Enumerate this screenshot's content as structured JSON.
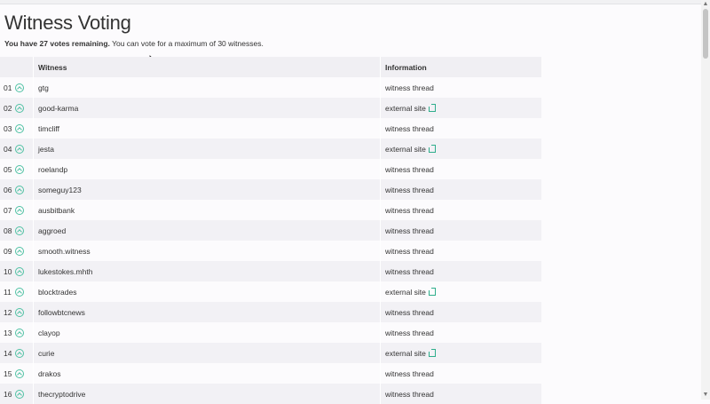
{
  "page": {
    "title": "Witness Voting",
    "votes_bold": "You have 27 votes remaining.",
    "votes_rest": " You can vote for a maximum of 30 witnesses."
  },
  "table": {
    "headers": {
      "rank": "",
      "witness": "Witness",
      "information": "Information"
    },
    "rows": [
      {
        "rank": "01",
        "name": "gtg",
        "info": "witness thread",
        "external": false
      },
      {
        "rank": "02",
        "name": "good-karma",
        "info": "external site",
        "external": true
      },
      {
        "rank": "03",
        "name": "timcliff",
        "info": "witness thread",
        "external": false
      },
      {
        "rank": "04",
        "name": "jesta",
        "info": "external site",
        "external": true
      },
      {
        "rank": "05",
        "name": "roelandp",
        "info": "witness thread",
        "external": false
      },
      {
        "rank": "06",
        "name": "someguy123",
        "info": "witness thread",
        "external": false
      },
      {
        "rank": "07",
        "name": "ausbitbank",
        "info": "witness thread",
        "external": false
      },
      {
        "rank": "08",
        "name": "aggroed",
        "info": "witness thread",
        "external": false
      },
      {
        "rank": "09",
        "name": "smooth.witness",
        "info": "witness thread",
        "external": false
      },
      {
        "rank": "10",
        "name": "lukestokes.mhth",
        "info": "witness thread",
        "external": false
      },
      {
        "rank": "11",
        "name": "blocktrades",
        "info": "external site",
        "external": true
      },
      {
        "rank": "12",
        "name": "followbtcnews",
        "info": "witness thread",
        "external": false
      },
      {
        "rank": "13",
        "name": "clayop",
        "info": "witness thread",
        "external": false
      },
      {
        "rank": "14",
        "name": "curie",
        "info": "external site",
        "external": true
      },
      {
        "rank": "15",
        "name": "drakos",
        "info": "witness thread",
        "external": false
      },
      {
        "rank": "16",
        "name": "thecryptodrive",
        "info": "witness thread",
        "external": false
      }
    ]
  },
  "icons": {
    "vote": "upvote-circle-icon",
    "external": "external-link-icon"
  },
  "colors": {
    "accent": "#4fc1a3",
    "stripe": "#f2f1f5",
    "background": "#fcfbfd"
  }
}
